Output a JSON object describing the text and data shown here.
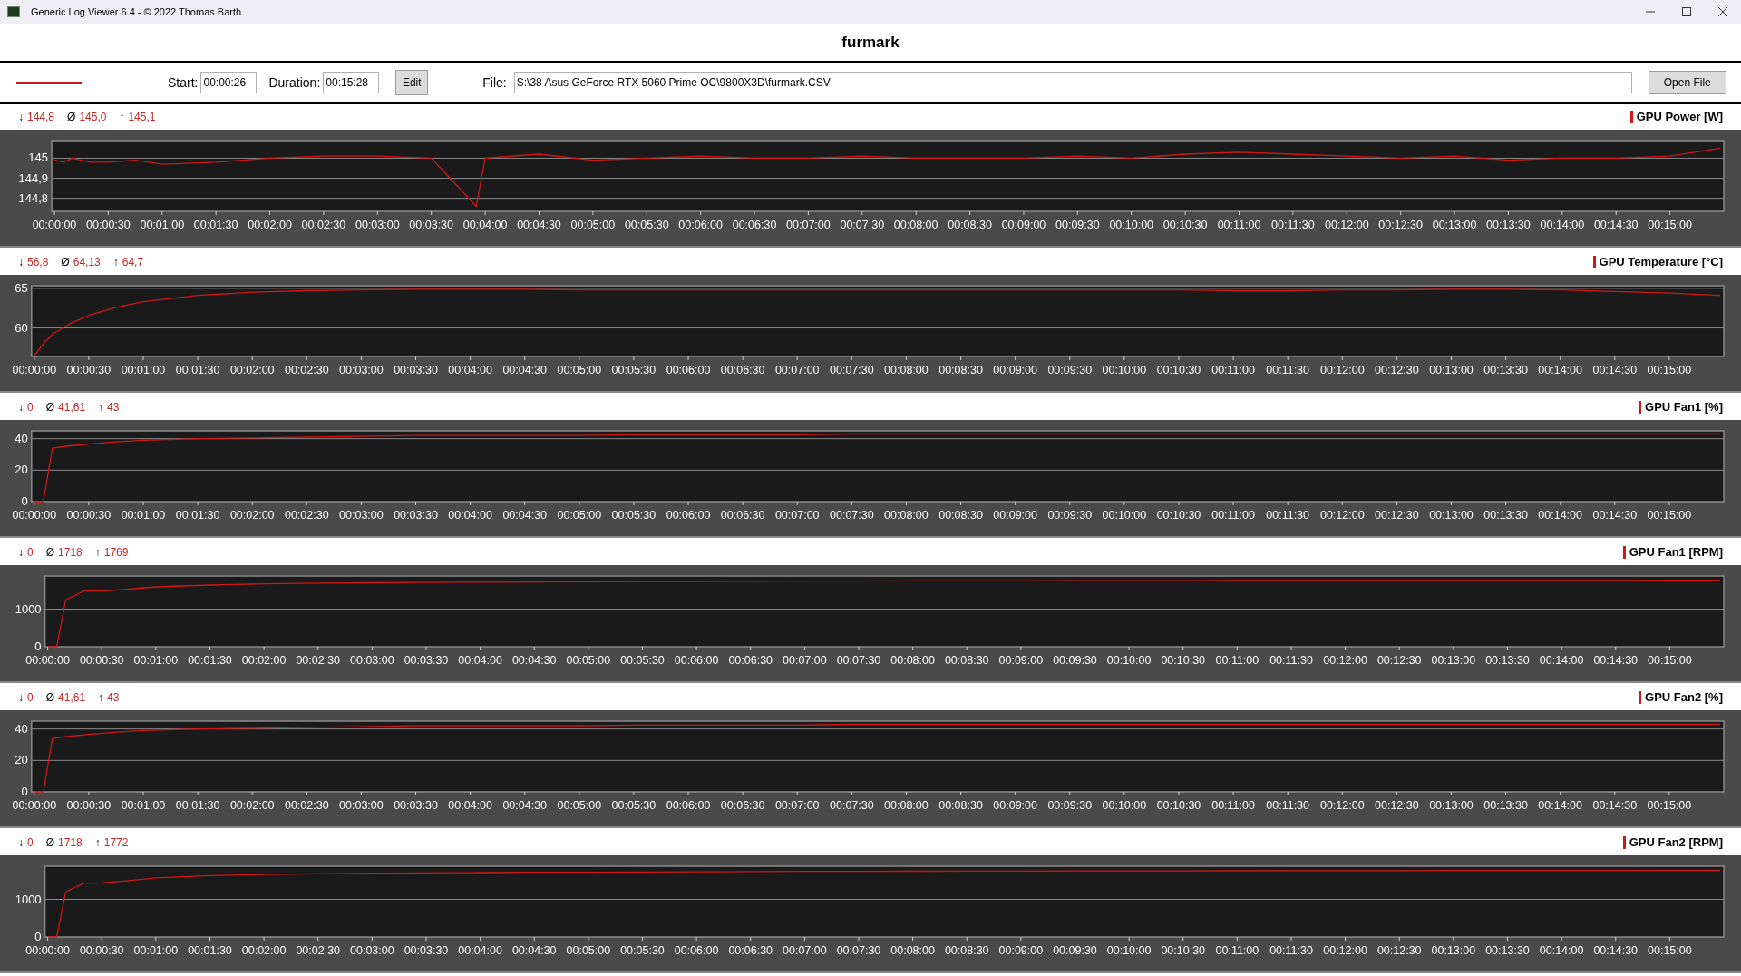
{
  "window": {
    "title": "Generic Log Viewer 6.4 - © 2022 Thomas Barth"
  },
  "heading": "furmark",
  "toolbar": {
    "start_label": "Start:",
    "start": "00:00:26",
    "duration_label": "Duration:",
    "duration": "00:15:28",
    "edit_button": "Edit",
    "file_label": "File:",
    "file": "S:\\38 Asus GeForce RTX 5060 Prime OC\\9800X3D\\furmark.CSV",
    "open_button": "Open File"
  },
  "charts": [
    {
      "stats": [
        {
          "symbol": "↓",
          "value": "144,8"
        },
        {
          "symbol": "Ø",
          "value": "145,0"
        },
        {
          "symbol": "↑",
          "value": "145,1"
        }
      ],
      "chart_data": {
        "type": "line",
        "x": [
          0,
          5,
          10,
          20,
          30,
          45,
          60,
          90,
          120,
          150,
          180,
          210,
          235,
          240,
          270,
          300,
          330,
          360,
          390,
          420,
          450,
          480,
          510,
          540,
          570,
          600,
          630,
          660,
          690,
          720,
          750,
          780,
          810,
          840,
          870,
          900,
          928
        ],
        "xlim": [
          0,
          930
        ],
        "ylim": [
          144.735,
          145.088
        ],
        "yticks": [
          {
            "value": 144.8,
            "label": "144,8"
          },
          {
            "value": 144.9,
            "label": "144,9"
          },
          {
            "value": 145,
            "label": "145"
          }
        ],
        "xticks": [
          {
            "value": 0,
            "label": "00:00:00"
          },
          {
            "value": 30,
            "label": "00:00:30"
          },
          {
            "value": 60,
            "label": "00:01:00"
          },
          {
            "value": 90,
            "label": "00:01:30"
          },
          {
            "value": 120,
            "label": "00:02:00"
          },
          {
            "value": 150,
            "label": "00:02:30"
          },
          {
            "value": 180,
            "label": "00:03:00"
          },
          {
            "value": 210,
            "label": "00:03:30"
          },
          {
            "value": 240,
            "label": "00:04:00"
          },
          {
            "value": 270,
            "label": "00:04:30"
          },
          {
            "value": 300,
            "label": "00:05:00"
          },
          {
            "value": 330,
            "label": "00:05:30"
          },
          {
            "value": 360,
            "label": "00:06:00"
          },
          {
            "value": 390,
            "label": "00:06:30"
          },
          {
            "value": 420,
            "label": "00:07:00"
          },
          {
            "value": 450,
            "label": "00:07:30"
          },
          {
            "value": 480,
            "label": "00:08:00"
          },
          {
            "value": 510,
            "label": "00:08:30"
          },
          {
            "value": 540,
            "label": "00:09:00"
          },
          {
            "value": 570,
            "label": "00:09:30"
          },
          {
            "value": 600,
            "label": "00:10:00"
          },
          {
            "value": 630,
            "label": "00:10:30"
          },
          {
            "value": 660,
            "label": "00:11:00"
          },
          {
            "value": 690,
            "label": "00:11:30"
          },
          {
            "value": 720,
            "label": "00:12:00"
          },
          {
            "value": 750,
            "label": "00:12:30"
          },
          {
            "value": 780,
            "label": "00:13:00"
          },
          {
            "value": 810,
            "label": "00:13:30"
          },
          {
            "value": 840,
            "label": "00:14:00"
          },
          {
            "value": 870,
            "label": "00:14:30"
          },
          {
            "value": 900,
            "label": "00:15:00"
          }
        ],
        "grid": true,
        "series": [
          {
            "name": "GPU Power [W]",
            "color": "#d01818",
            "values": [
              144.99,
              144.98,
              145.0,
              144.98,
              144.98,
              144.99,
              144.97,
              144.98,
              145.0,
              145.01,
              145.01,
              145.0,
              144.76,
              145.0,
              145.02,
              144.99,
              145.0,
              145.01,
              145.0,
              145.0,
              145.01,
              145.0,
              145.0,
              145.0,
              145.01,
              145.0,
              145.02,
              145.03,
              145.02,
              145.01,
              145.0,
              145.01,
              144.99,
              145.0,
              145.0,
              145.01,
              145.05
            ]
          }
        ]
      }
    },
    {
      "stats": [
        {
          "symbol": "↓",
          "value": "56,8"
        },
        {
          "symbol": "Ø",
          "value": "64,13"
        },
        {
          "symbol": "↑",
          "value": "64,7"
        }
      ],
      "chart_data": {
        "type": "line",
        "x": [
          0,
          5,
          10,
          20,
          30,
          45,
          60,
          90,
          120,
          150,
          180,
          210,
          235,
          240,
          270,
          300,
          330,
          360,
          390,
          420,
          450,
          480,
          510,
          540,
          570,
          600,
          630,
          660,
          690,
          720,
          750,
          780,
          810,
          840,
          870,
          900,
          928
        ],
        "xlim": [
          0,
          930
        ],
        "ylim": [
          56.4,
          65.33
        ],
        "yticks": [
          60,
          65
        ],
        "xticks": [
          {
            "value": 0,
            "label": "00:00:00"
          },
          {
            "value": 30,
            "label": "00:00:30"
          },
          {
            "value": 60,
            "label": "00:01:00"
          },
          {
            "value": 90,
            "label": "00:01:30"
          },
          {
            "value": 120,
            "label": "00:02:00"
          },
          {
            "value": 150,
            "label": "00:02:30"
          },
          {
            "value": 180,
            "label": "00:03:00"
          },
          {
            "value": 210,
            "label": "00:03:30"
          },
          {
            "value": 240,
            "label": "00:04:00"
          },
          {
            "value": 270,
            "label": "00:04:30"
          },
          {
            "value": 300,
            "label": "00:05:00"
          },
          {
            "value": 330,
            "label": "00:05:30"
          },
          {
            "value": 360,
            "label": "00:06:00"
          },
          {
            "value": 390,
            "label": "00:06:30"
          },
          {
            "value": 420,
            "label": "00:07:00"
          },
          {
            "value": 450,
            "label": "00:07:30"
          },
          {
            "value": 480,
            "label": "00:08:00"
          },
          {
            "value": 510,
            "label": "00:08:30"
          },
          {
            "value": 540,
            "label": "00:09:00"
          },
          {
            "value": 570,
            "label": "00:09:30"
          },
          {
            "value": 600,
            "label": "00:10:00"
          },
          {
            "value": 630,
            "label": "00:10:30"
          },
          {
            "value": 660,
            "label": "00:11:00"
          },
          {
            "value": 690,
            "label": "00:11:30"
          },
          {
            "value": 720,
            "label": "00:12:00"
          },
          {
            "value": 750,
            "label": "00:12:30"
          },
          {
            "value": 780,
            "label": "00:13:00"
          },
          {
            "value": 810,
            "label": "00:13:30"
          },
          {
            "value": 840,
            "label": "00:14:00"
          },
          {
            "value": 870,
            "label": "00:14:30"
          },
          {
            "value": 900,
            "label": "00:15:00"
          }
        ],
        "grid": true,
        "series": [
          {
            "name": "GPU Temperature [°C]",
            "color": "#d01818",
            "values": [
              56.5,
              58.0,
              59.2,
              60.6,
              61.6,
              62.6,
              63.3,
              64.1,
              64.5,
              64.7,
              64.8,
              64.9,
              64.9,
              64.9,
              64.9,
              64.8,
              64.8,
              64.8,
              64.8,
              64.8,
              64.8,
              64.8,
              64.8,
              64.8,
              64.8,
              64.8,
              64.8,
              64.7,
              64.7,
              64.8,
              64.8,
              64.9,
              64.9,
              64.8,
              64.6,
              64.4,
              64.1
            ]
          }
        ]
      }
    },
    {
      "stats": [
        {
          "symbol": "↓",
          "value": "0"
        },
        {
          "symbol": "Ø",
          "value": "41,61"
        },
        {
          "symbol": "↑",
          "value": "43"
        }
      ],
      "chart_data": {
        "type": "line",
        "x": [
          0,
          5,
          10,
          20,
          30,
          45,
          60,
          90,
          120,
          150,
          180,
          210,
          235,
          240,
          270,
          300,
          330,
          360,
          390,
          420,
          450,
          480,
          510,
          540,
          570,
          600,
          630,
          660,
          690,
          720,
          750,
          780,
          810,
          840,
          870,
          900,
          928
        ],
        "xlim": [
          0,
          930
        ],
        "ylim": [
          0,
          45
        ],
        "yticks": [
          0,
          20,
          40
        ],
        "xticks": [
          {
            "value": 0,
            "label": "00:00:00"
          },
          {
            "value": 30,
            "label": "00:00:30"
          },
          {
            "value": 60,
            "label": "00:01:00"
          },
          {
            "value": 90,
            "label": "00:01:30"
          },
          {
            "value": 120,
            "label": "00:02:00"
          },
          {
            "value": 150,
            "label": "00:02:30"
          },
          {
            "value": 180,
            "label": "00:03:00"
          },
          {
            "value": 210,
            "label": "00:03:30"
          },
          {
            "value": 240,
            "label": "00:04:00"
          },
          {
            "value": 270,
            "label": "00:04:30"
          },
          {
            "value": 300,
            "label": "00:05:00"
          },
          {
            "value": 330,
            "label": "00:05:30"
          },
          {
            "value": 360,
            "label": "00:06:00"
          },
          {
            "value": 390,
            "label": "00:06:30"
          },
          {
            "value": 420,
            "label": "00:07:00"
          },
          {
            "value": 450,
            "label": "00:07:30"
          },
          {
            "value": 480,
            "label": "00:08:00"
          },
          {
            "value": 510,
            "label": "00:08:30"
          },
          {
            "value": 540,
            "label": "00:09:00"
          },
          {
            "value": 570,
            "label": "00:09:30"
          },
          {
            "value": 600,
            "label": "00:10:00"
          },
          {
            "value": 630,
            "label": "00:10:30"
          },
          {
            "value": 660,
            "label": "00:11:00"
          },
          {
            "value": 690,
            "label": "00:11:30"
          },
          {
            "value": 720,
            "label": "00:12:00"
          },
          {
            "value": 750,
            "label": "00:12:30"
          },
          {
            "value": 780,
            "label": "00:13:00"
          },
          {
            "value": 810,
            "label": "00:13:30"
          },
          {
            "value": 840,
            "label": "00:14:00"
          },
          {
            "value": 870,
            "label": "00:14:30"
          },
          {
            "value": 900,
            "label": "00:15:00"
          }
        ],
        "grid": true,
        "series": [
          {
            "name": "GPU Fan1 [%]",
            "color": "#d01818",
            "values": [
              0,
              0,
              34,
              35.5,
              36.5,
              38,
              39,
              40,
              40.5,
              41,
              41.5,
              42,
              42,
              42,
              42,
              42,
              42.5,
              42.5,
              42.5,
              42.5,
              43,
              43,
              43,
              43,
              43,
              43,
              43,
              43,
              43,
              43,
              43,
              43,
              43,
              43,
              43,
              43,
              43
            ]
          }
        ]
      }
    },
    {
      "stats": [
        {
          "symbol": "↓",
          "value": "0"
        },
        {
          "symbol": "Ø",
          "value": "1718"
        },
        {
          "symbol": "↑",
          "value": "1769"
        }
      ],
      "chart_data": {
        "type": "line",
        "x": [
          0,
          5,
          10,
          20,
          30,
          45,
          60,
          90,
          120,
          150,
          180,
          210,
          235,
          240,
          270,
          300,
          330,
          360,
          390,
          420,
          450,
          480,
          510,
          540,
          570,
          600,
          630,
          660,
          690,
          720,
          750,
          780,
          810,
          840,
          870,
          900,
          928
        ],
        "xlim": [
          0,
          930
        ],
        "ylim": [
          0,
          1880
        ],
        "yticks": [
          0,
          1000
        ],
        "xticks": [
          {
            "value": 0,
            "label": "00:00:00"
          },
          {
            "value": 30,
            "label": "00:00:30"
          },
          {
            "value": 60,
            "label": "00:01:00"
          },
          {
            "value": 90,
            "label": "00:01:30"
          },
          {
            "value": 120,
            "label": "00:02:00"
          },
          {
            "value": 150,
            "label": "00:02:30"
          },
          {
            "value": 180,
            "label": "00:03:00"
          },
          {
            "value": 210,
            "label": "00:03:30"
          },
          {
            "value": 240,
            "label": "00:04:00"
          },
          {
            "value": 270,
            "label": "00:04:30"
          },
          {
            "value": 300,
            "label": "00:05:00"
          },
          {
            "value": 330,
            "label": "00:05:30"
          },
          {
            "value": 360,
            "label": "00:06:00"
          },
          {
            "value": 390,
            "label": "00:06:30"
          },
          {
            "value": 420,
            "label": "00:07:00"
          },
          {
            "value": 450,
            "label": "00:07:30"
          },
          {
            "value": 480,
            "label": "00:08:00"
          },
          {
            "value": 510,
            "label": "00:08:30"
          },
          {
            "value": 540,
            "label": "00:09:00"
          },
          {
            "value": 570,
            "label": "00:09:30"
          },
          {
            "value": 600,
            "label": "00:10:00"
          },
          {
            "value": 630,
            "label": "00:10:30"
          },
          {
            "value": 660,
            "label": "00:11:00"
          },
          {
            "value": 690,
            "label": "00:11:30"
          },
          {
            "value": 720,
            "label": "00:12:00"
          },
          {
            "value": 750,
            "label": "00:12:30"
          },
          {
            "value": 780,
            "label": "00:13:00"
          },
          {
            "value": 810,
            "label": "00:13:30"
          },
          {
            "value": 840,
            "label": "00:14:00"
          },
          {
            "value": 870,
            "label": "00:14:30"
          },
          {
            "value": 900,
            "label": "00:15:00"
          }
        ],
        "grid": true,
        "series": [
          {
            "name": "GPU Fan1 [RPM]",
            "color": "#d01818",
            "values": [
              0,
              0,
              1250,
              1480,
              1480,
              1530,
              1590,
              1640,
              1670,
              1690,
              1700,
              1710,
              1715,
              1715,
              1720,
              1725,
              1730,
              1735,
              1740,
              1745,
              1745,
              1750,
              1750,
              1750,
              1755,
              1755,
              1755,
              1760,
              1760,
              1760,
              1760,
              1765,
              1765,
              1765,
              1765,
              1769,
              1769
            ]
          }
        ]
      }
    },
    {
      "stats": [
        {
          "symbol": "↓",
          "value": "0"
        },
        {
          "symbol": "Ø",
          "value": "41,61"
        },
        {
          "symbol": "↑",
          "value": "43"
        }
      ],
      "chart_data": {
        "type": "line",
        "x": [
          0,
          5,
          10,
          20,
          30,
          45,
          60,
          90,
          120,
          150,
          180,
          210,
          235,
          240,
          270,
          300,
          330,
          360,
          390,
          420,
          450,
          480,
          510,
          540,
          570,
          600,
          630,
          660,
          690,
          720,
          750,
          780,
          810,
          840,
          870,
          900,
          928
        ],
        "xlim": [
          0,
          930
        ],
        "ylim": [
          0,
          45
        ],
        "yticks": [
          0,
          20,
          40
        ],
        "xticks": [
          {
            "value": 0,
            "label": "00:00:00"
          },
          {
            "value": 30,
            "label": "00:00:30"
          },
          {
            "value": 60,
            "label": "00:01:00"
          },
          {
            "value": 90,
            "label": "00:01:30"
          },
          {
            "value": 120,
            "label": "00:02:00"
          },
          {
            "value": 150,
            "label": "00:02:30"
          },
          {
            "value": 180,
            "label": "00:03:00"
          },
          {
            "value": 210,
            "label": "00:03:30"
          },
          {
            "value": 240,
            "label": "00:04:00"
          },
          {
            "value": 270,
            "label": "00:04:30"
          },
          {
            "value": 300,
            "label": "00:05:00"
          },
          {
            "value": 330,
            "label": "00:05:30"
          },
          {
            "value": 360,
            "label": "00:06:00"
          },
          {
            "value": 390,
            "label": "00:06:30"
          },
          {
            "value": 420,
            "label": "00:07:00"
          },
          {
            "value": 450,
            "label": "00:07:30"
          },
          {
            "value": 480,
            "label": "00:08:00"
          },
          {
            "value": 510,
            "label": "00:08:30"
          },
          {
            "value": 540,
            "label": "00:09:00"
          },
          {
            "value": 570,
            "label": "00:09:30"
          },
          {
            "value": 600,
            "label": "00:10:00"
          },
          {
            "value": 630,
            "label": "00:10:30"
          },
          {
            "value": 660,
            "label": "00:11:00"
          },
          {
            "value": 690,
            "label": "00:11:30"
          },
          {
            "value": 720,
            "label": "00:12:00"
          },
          {
            "value": 750,
            "label": "00:12:30"
          },
          {
            "value": 780,
            "label": "00:13:00"
          },
          {
            "value": 810,
            "label": "00:13:30"
          },
          {
            "value": 840,
            "label": "00:14:00"
          },
          {
            "value": 870,
            "label": "00:14:30"
          },
          {
            "value": 900,
            "label": "00:15:00"
          }
        ],
        "grid": true,
        "series": [
          {
            "name": "GPU Fan2 [%]",
            "color": "#d01818",
            "values": [
              0,
              0,
              34,
              35.5,
              36.5,
              38,
              39,
              40,
              40.5,
              41,
              41.5,
              42,
              42,
              42,
              42,
              42,
              42.5,
              42.5,
              42.5,
              42.5,
              43,
              43,
              43,
              43,
              43,
              43,
              43,
              43,
              43,
              43,
              43,
              43,
              43,
              43,
              43,
              43,
              43
            ]
          }
        ]
      }
    },
    {
      "stats": [
        {
          "symbol": "↓",
          "value": "0"
        },
        {
          "symbol": "Ø",
          "value": "1718"
        },
        {
          "symbol": "↑",
          "value": "1772"
        }
      ],
      "chart_data": {
        "type": "line",
        "x": [
          0,
          5,
          10,
          20,
          30,
          45,
          60,
          90,
          120,
          150,
          180,
          210,
          235,
          240,
          270,
          300,
          330,
          360,
          390,
          420,
          450,
          480,
          510,
          540,
          570,
          600,
          630,
          660,
          690,
          720,
          750,
          780,
          810,
          840,
          870,
          900,
          928
        ],
        "xlim": [
          0,
          930
        ],
        "ylim": [
          0,
          1880
        ],
        "yticks": [
          0,
          1000
        ],
        "xticks": [
          {
            "value": 0,
            "label": "00:00:00"
          },
          {
            "value": 30,
            "label": "00:00:30"
          },
          {
            "value": 60,
            "label": "00:01:00"
          },
          {
            "value": 90,
            "label": "00:01:30"
          },
          {
            "value": 120,
            "label": "00:02:00"
          },
          {
            "value": 150,
            "label": "00:02:30"
          },
          {
            "value": 180,
            "label": "00:03:00"
          },
          {
            "value": 210,
            "label": "00:03:30"
          },
          {
            "value": 240,
            "label": "00:04:00"
          },
          {
            "value": 270,
            "label": "00:04:30"
          },
          {
            "value": 300,
            "label": "00:05:00"
          },
          {
            "value": 330,
            "label": "00:05:30"
          },
          {
            "value": 360,
            "label": "00:06:00"
          },
          {
            "value": 390,
            "label": "00:06:30"
          },
          {
            "value": 420,
            "label": "00:07:00"
          },
          {
            "value": 450,
            "label": "00:07:30"
          },
          {
            "value": 480,
            "label": "00:08:00"
          },
          {
            "value": 510,
            "label": "00:08:30"
          },
          {
            "value": 540,
            "label": "00:09:00"
          },
          {
            "value": 570,
            "label": "00:09:30"
          },
          {
            "value": 600,
            "label": "00:10:00"
          },
          {
            "value": 630,
            "label": "00:10:30"
          },
          {
            "value": 660,
            "label": "00:11:00"
          },
          {
            "value": 690,
            "label": "00:11:30"
          },
          {
            "value": 720,
            "label": "00:12:00"
          },
          {
            "value": 750,
            "label": "00:12:30"
          },
          {
            "value": 780,
            "label": "00:13:00"
          },
          {
            "value": 810,
            "label": "00:13:30"
          },
          {
            "value": 840,
            "label": "00:14:00"
          },
          {
            "value": 870,
            "label": "00:14:30"
          },
          {
            "value": 900,
            "label": "00:15:00"
          }
        ],
        "grid": true,
        "series": [
          {
            "name": "GPU Fan2 [RPM]",
            "color": "#d01818",
            "values": [
              0,
              0,
              1200,
              1430,
              1440,
              1500,
              1570,
              1630,
              1660,
              1680,
              1695,
              1705,
              1710,
              1712,
              1718,
              1722,
              1728,
              1732,
              1738,
              1742,
              1745,
              1748,
              1750,
              1752,
              1755,
              1756,
              1758,
              1760,
              1762,
              1763,
              1765,
              1766,
              1768,
              1770,
              1770,
              1772,
              1772
            ]
          }
        ]
      }
    }
  ]
}
